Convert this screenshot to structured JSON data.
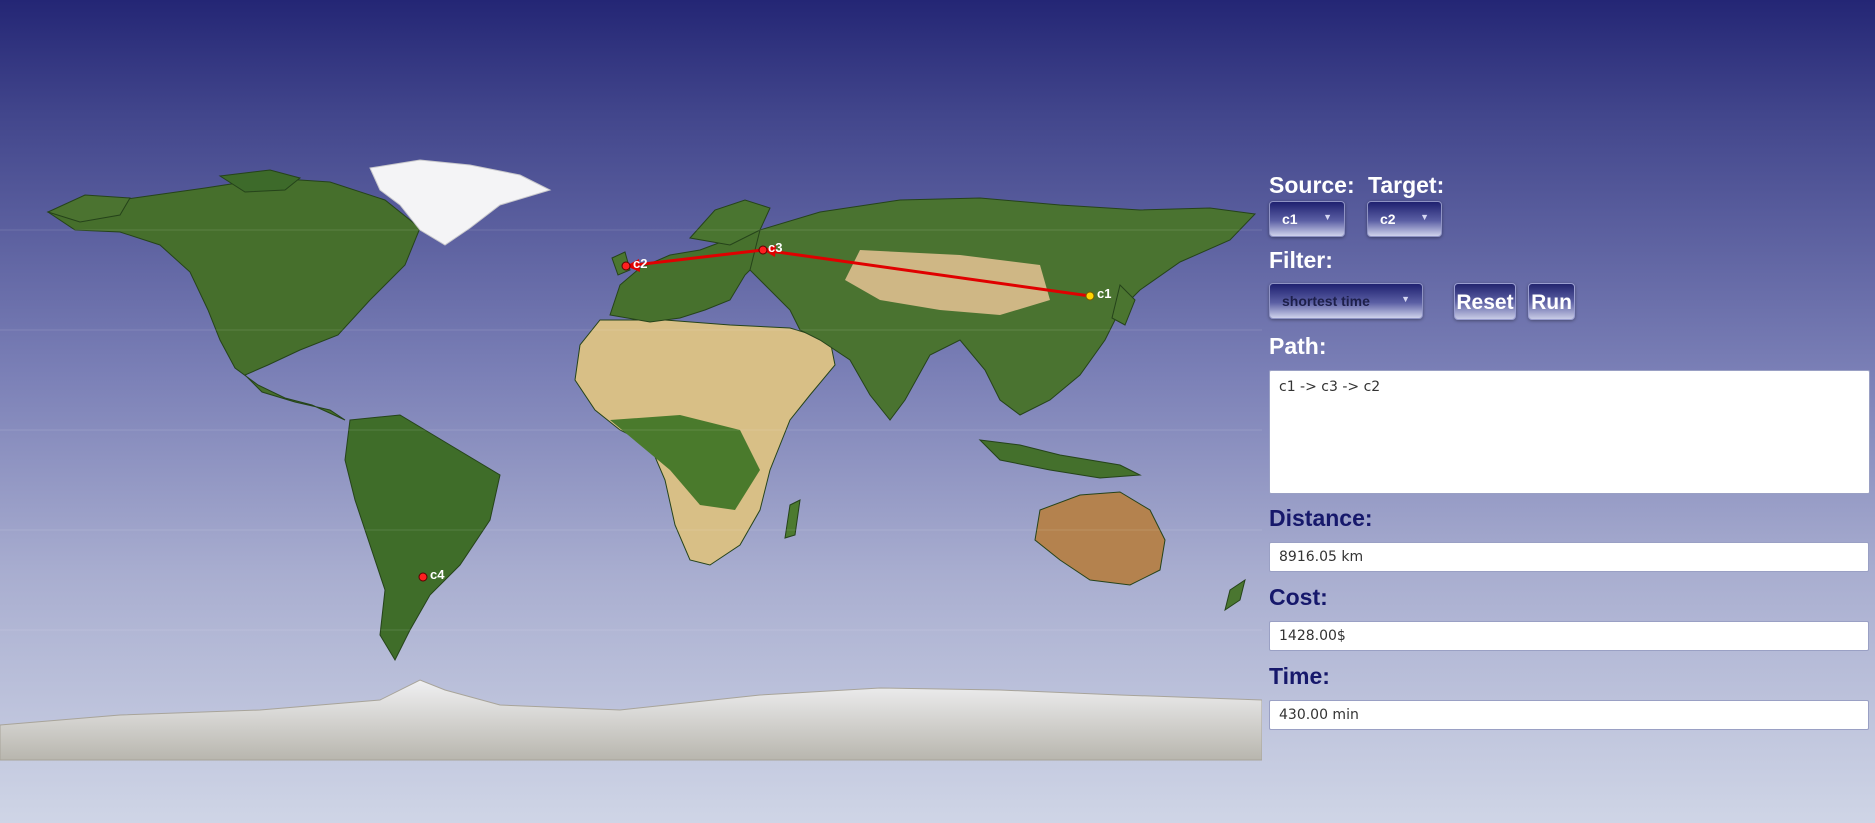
{
  "map": {
    "route": [
      "c1",
      "c3",
      "c2"
    ],
    "cities": [
      {
        "name": "c1",
        "label": "c1",
        "color": "#ffd400",
        "on_route": true
      },
      {
        "name": "c2",
        "label": "c2",
        "color": "#ff2020",
        "on_route": true
      },
      {
        "name": "c3",
        "label": "c3",
        "color": "#ff2020",
        "on_route": true
      },
      {
        "name": "c4",
        "label": "c4",
        "color": "#ff2020",
        "on_route": false
      }
    ],
    "route_color": "#e00000",
    "land_color": "#3e6a2a",
    "desert_color": "#d8c08a",
    "ice_color": "#f2f2f2"
  },
  "panel": {
    "source_label": "Source:",
    "target_label": "Target:",
    "source_value": "c1",
    "target_value": "c2",
    "filter_label": "Filter:",
    "filter_value": "shortest time",
    "reset_label": "Reset",
    "run_label": "Run",
    "path_label": "Path:",
    "path_value": "c1 -> c3 -> c2",
    "distance_label": "Distance:",
    "distance_value": "8916.05 km",
    "cost_label": "Cost:",
    "cost_value": "1428.00$",
    "time_label": "Time:",
    "time_value": "430.00 min"
  }
}
